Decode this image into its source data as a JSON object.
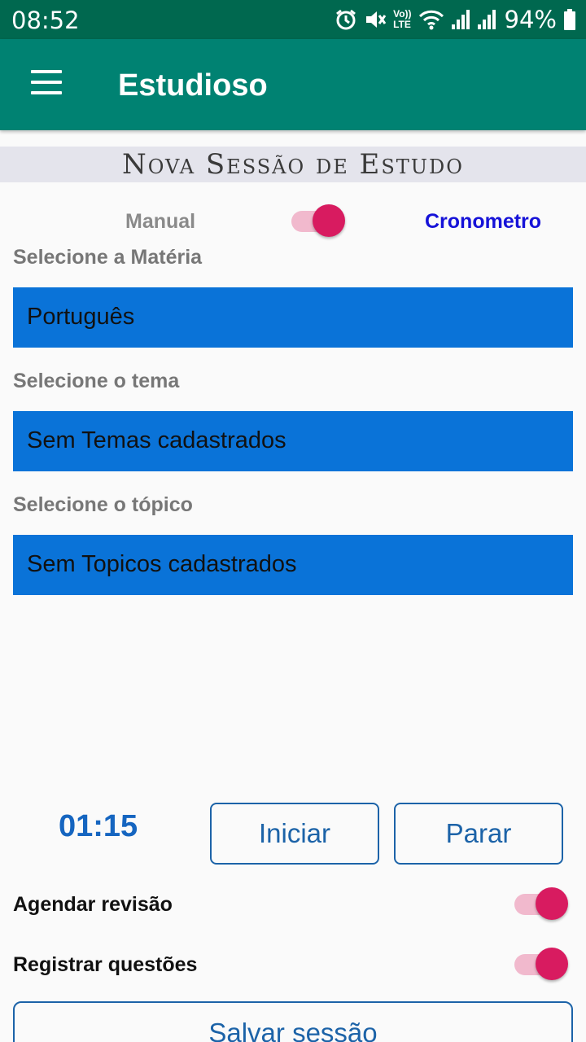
{
  "status_bar": {
    "time": "08:52",
    "battery": "94%",
    "icons": [
      "alarm-icon",
      "mute-icon",
      "volte-icon",
      "wifi-icon",
      "signal-icon",
      "signal-icon",
      "battery-icon"
    ],
    "volte_top": "Vo))",
    "volte_bottom": "LTE"
  },
  "app_bar": {
    "title": "Estudioso",
    "menu_icon": "menu-icon"
  },
  "section": {
    "title": "Nova Sessão de Estudo"
  },
  "mode": {
    "manual_label": "Manual",
    "crono_label": "Cronometro",
    "toggle_on": true
  },
  "form": {
    "subject_label": "Selecione a Matéria",
    "subject_value": "Português",
    "theme_label": "Selecione o tema",
    "theme_value": "Sem Temas cadastrados",
    "topic_label": "Selecione o tópico",
    "topic_value": "Sem Topicos cadastrados"
  },
  "timer": {
    "value": "01:15",
    "start_label": "Iniciar",
    "stop_label": "Parar"
  },
  "options": {
    "review_label": "Agendar revisão",
    "review_on": true,
    "questions_label": "Registrar questões",
    "questions_on": true
  },
  "save_label": "Salvar sessão",
  "colors": {
    "status_bar": "#00684f",
    "app_bar": "#008272",
    "select_bg": "#0a73d8",
    "accent": "#d81b60",
    "button": "#1c63a8",
    "crono_text": "#1612d8"
  }
}
